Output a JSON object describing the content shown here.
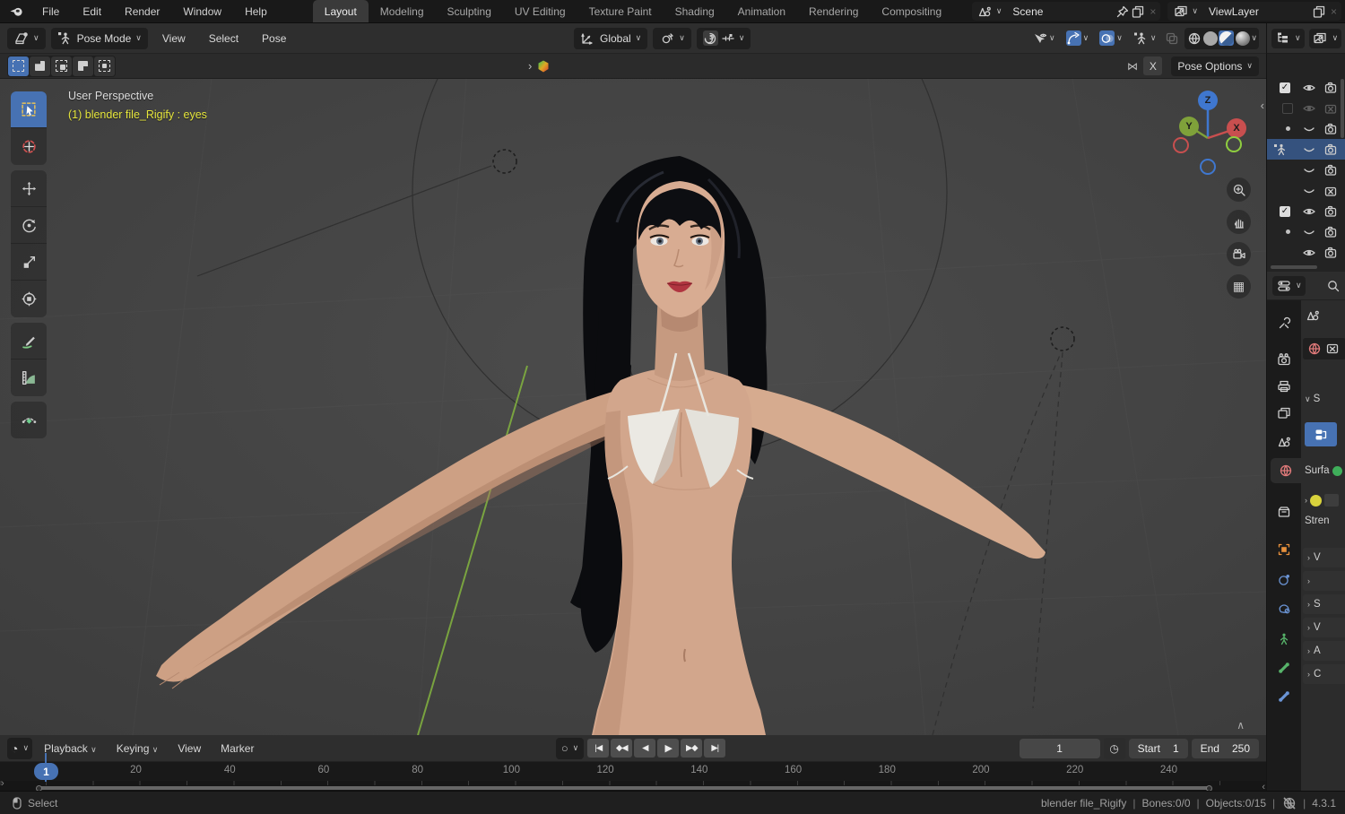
{
  "icons": {
    "chevron_down": "∨",
    "chevron_right": "›",
    "chevron_left": "‹",
    "chevron_up": "∧",
    "close": "×",
    "check": "✓",
    "record": "○",
    "jump_start": "|◀",
    "prev_key": "◆◀",
    "play_rev": "◀",
    "play_fwd": "▶",
    "next_key": "▶◆",
    "jump_end": "▶|",
    "stopwatch": "◷",
    "clock": "◔",
    "mirror": "⋈",
    "grid": "▦"
  },
  "colors": {
    "accent": "#4772b3",
    "selection": "#35527e",
    "axis-x": "#c84f4f",
    "axis-y": "#7fa13a",
    "axis-z": "#3f77cf",
    "object-label": "#e6e63c",
    "world-tab": "#e07a7a",
    "green-axis": "#7fae3f"
  },
  "topbar": {
    "menus": [
      "File",
      "Edit",
      "Render",
      "Window",
      "Help"
    ],
    "workspaces": [
      "Layout",
      "Modeling",
      "Sculpting",
      "UV Editing",
      "Texture Paint",
      "Shading",
      "Animation",
      "Rendering",
      "Compositing"
    ],
    "active_workspace": "Layout",
    "scene_value": "Scene",
    "viewlayer_value": "ViewLayer"
  },
  "viewport_header": {
    "mode": "Pose Mode",
    "menus": [
      "View",
      "Select",
      "Pose"
    ],
    "orientation": "Global"
  },
  "tool_settings": {
    "mirror_axis": "X",
    "pose_options": "Pose Options"
  },
  "viewport": {
    "perspective_label": "User Perspective",
    "object_label": "(1) blender file_Rigify : eyes",
    "axes": {
      "x": "X",
      "y": "Y",
      "z": "Z"
    }
  },
  "timeline": {
    "menus": [
      "Playback",
      "Keying",
      "View",
      "Marker"
    ],
    "current_frame": "1",
    "start_label": "Start",
    "start_value": "1",
    "end_label": "End",
    "end_value": "250",
    "ticks": [
      "20",
      "40",
      "60",
      "80",
      "100",
      "120",
      "140",
      "160",
      "180",
      "200",
      "220",
      "240"
    ]
  },
  "statusbar": {
    "select_label": "Select",
    "separator": "|",
    "file_info": "blender file_Rigify",
    "bones_info": "Bones:0/0",
    "objects_info": "Objects:0/15",
    "version": "4.3.1"
  },
  "properties": {
    "surface_panel_fragment": "S",
    "surface_label_fragment": "Surfa",
    "strength_label_fragment": "Stren",
    "collapsed_panels": [
      "V",
      "",
      "S",
      "V",
      "A",
      "C"
    ]
  }
}
